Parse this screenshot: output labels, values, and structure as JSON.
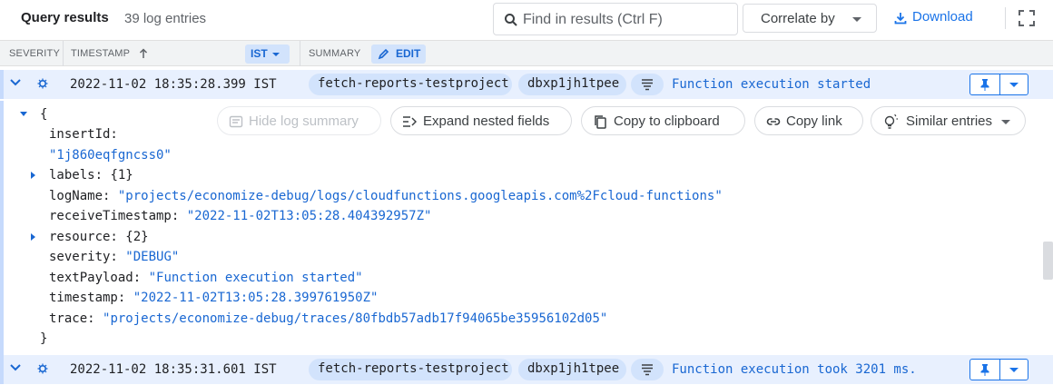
{
  "header": {
    "title": "Query results",
    "count": "39 log entries",
    "search_placeholder": "Find in results (Ctrl F)",
    "correlate_label": "Correlate by",
    "download_label": "Download"
  },
  "columns": {
    "severity": "SEVERITY",
    "timestamp": "TIMESTAMP",
    "timezone": "IST",
    "summary": "SUMMARY",
    "edit": "EDIT"
  },
  "rows": [
    {
      "timestamp": "2022-11-02 18:35:28.399 IST",
      "chip1": "fetch-reports-testproject",
      "chip2": "dbxp1jh1tpee",
      "summary": "Function execution started"
    },
    {
      "timestamp": "2022-11-02 18:35:31.601 IST",
      "chip1": "fetch-reports-testproject",
      "chip2": "dbxp1jh1tpee",
      "summary": "Function execution took 3201 ms."
    }
  ],
  "actions": {
    "hide_summary": "Hide log summary",
    "expand_nested": "Expand nested fields",
    "copy_clipboard": "Copy to clipboard",
    "copy_link": "Copy link",
    "similar": "Similar entries"
  },
  "json_view": {
    "open_brace": "{",
    "close_brace": "}",
    "insertId_key": "insertId:",
    "insertId_val": "\"1j860eqfgncss0\"",
    "labels_key": "labels:",
    "labels_val": "{1}",
    "logName_key": "logName:",
    "logName_val": "\"projects/economize-debug/logs/cloudfunctions.googleapis.com%2Fcloud-functions\"",
    "receiveTimestamp_key": "receiveTimestamp:",
    "receiveTimestamp_val": "\"2022-11-02T13:05:28.404392957Z\"",
    "resource_key": "resource:",
    "resource_val": "{2}",
    "severity_key": "severity:",
    "severity_val": "\"DEBUG\"",
    "textPayload_key": "textPayload:",
    "textPayload_val": "\"Function execution started\"",
    "timestamp_key": "timestamp:",
    "timestamp_val": "\"2022-11-02T13:05:28.399761950Z\"",
    "trace_key": "trace:",
    "trace_val": "\"projects/economize-debug/traces/80fbdb57adb17f94065be35956102d05\""
  },
  "colors": {
    "accent": "#1a73e8",
    "row_bg": "#e8f0fe",
    "chip_bg": "#d2e3fc",
    "value_text": "#1967d2"
  }
}
